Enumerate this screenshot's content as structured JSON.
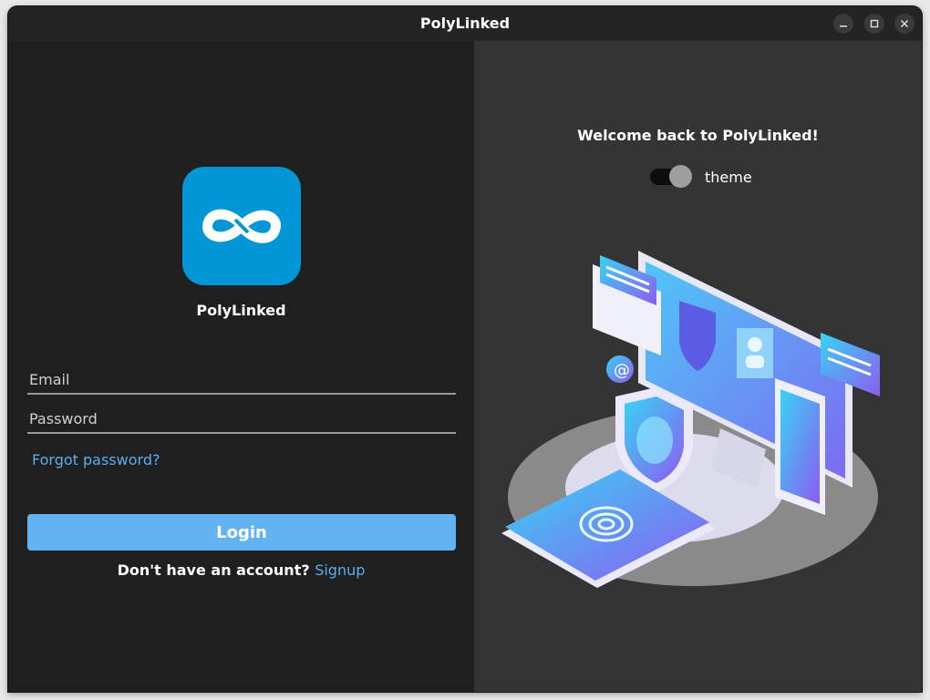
{
  "window": {
    "title": "PolyLinked"
  },
  "left": {
    "app_name": "PolyLinked",
    "email": {
      "placeholder": "Email",
      "value": ""
    },
    "password": {
      "placeholder": "Password",
      "value": ""
    },
    "forgot_label": "Forgot password?",
    "login_label": "Login",
    "no_account_text": "Don't have an account?",
    "signup_label": "Signup"
  },
  "right": {
    "welcome": "Welcome back to PolyLinked!",
    "theme_label": "theme",
    "theme_toggle_on": true
  },
  "colors": {
    "accent": "#63b3f3",
    "link": "#5aaef0",
    "logo_bg": "#0396d7",
    "left_bg": "#1f1f1f",
    "right_bg": "#343434"
  },
  "icons": [
    "minimize-icon",
    "maximize-icon",
    "close-icon",
    "infinity-logo-icon"
  ]
}
